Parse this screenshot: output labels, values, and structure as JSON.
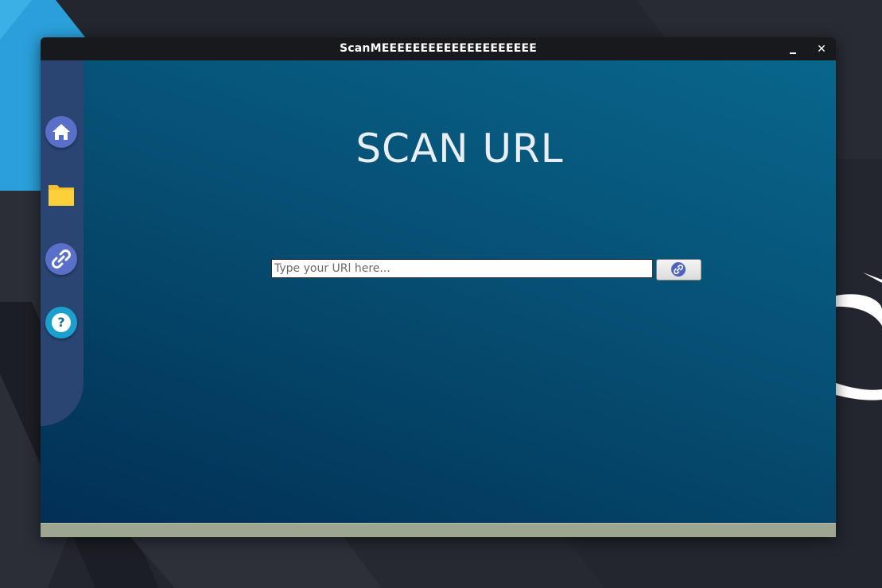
{
  "window": {
    "title": "ScanMEEEEEEEEEEEEEEEEEEEE",
    "minimize_label": "minimize",
    "close_label": "✕"
  },
  "sidebar": {
    "items": [
      {
        "name": "home",
        "icon": "home-icon"
      },
      {
        "name": "files",
        "icon": "folder-icon"
      },
      {
        "name": "scan-url",
        "icon": "link-icon"
      },
      {
        "name": "help",
        "icon": "help-icon",
        "glyph": "?"
      }
    ]
  },
  "main": {
    "title": "SCAN URL",
    "url_input": {
      "value": "",
      "placeholder": "Type your URl here..."
    },
    "scan_button": {
      "icon": "link-icon"
    }
  },
  "colors": {
    "titlebar": "#18191c",
    "sidebar": "#2a4572",
    "content_top": "#08668c",
    "content_bottom": "#032f55",
    "button_accent": "#5a6fc7",
    "help_accent": "#1aa0cf",
    "folder": "#f5c12e",
    "statusbar": "#9da690"
  }
}
